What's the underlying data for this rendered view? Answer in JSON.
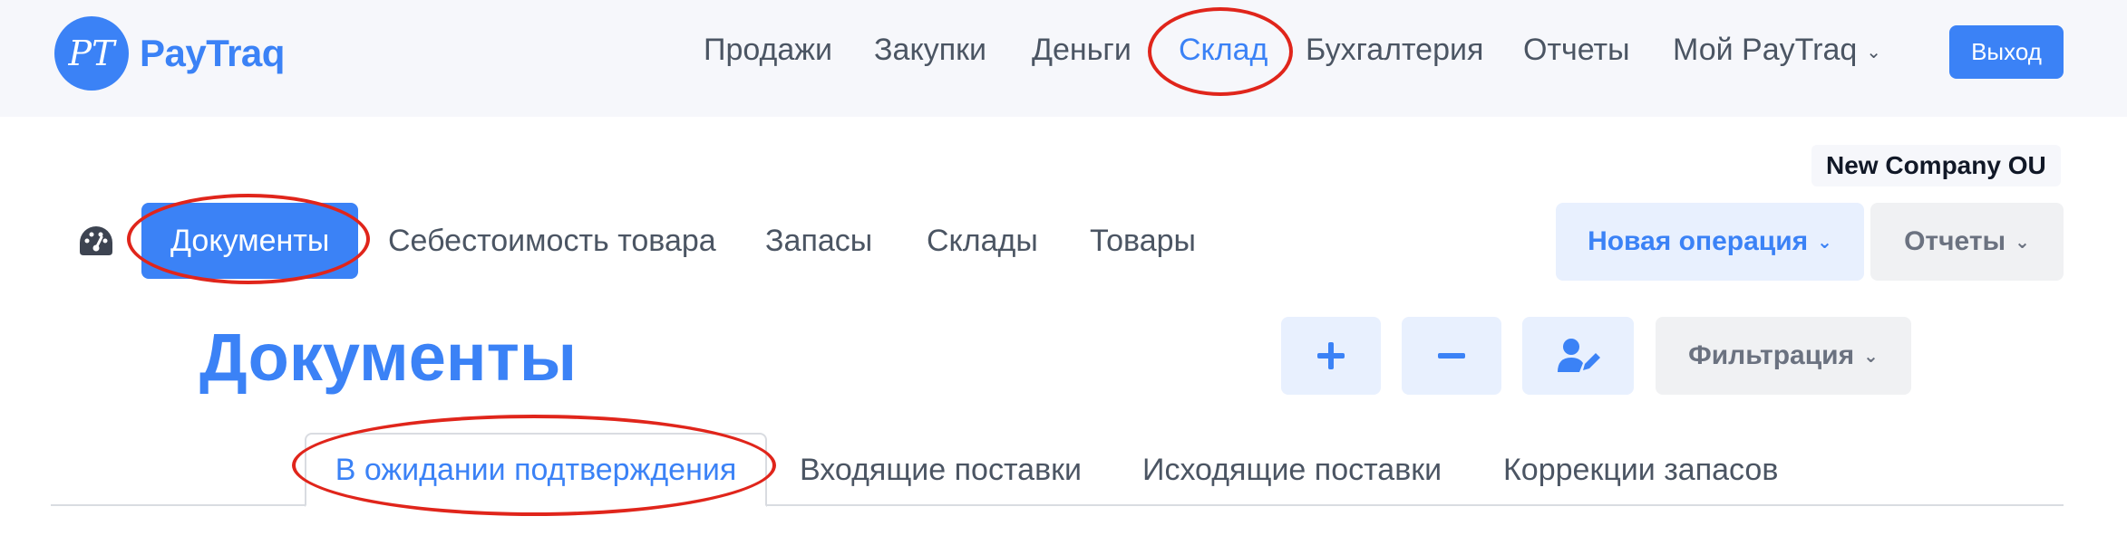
{
  "header": {
    "logo_initials": "PT",
    "brand": "PayTraq",
    "nav": [
      {
        "label": "Продажи"
      },
      {
        "label": "Закупки"
      },
      {
        "label": "Деньги"
      },
      {
        "label": "Склад",
        "active": true
      },
      {
        "label": "Бухгалтерия"
      },
      {
        "label": "Отчеты"
      },
      {
        "label": "Мой PayTraq",
        "dropdown": true
      }
    ],
    "logout_label": "Выход"
  },
  "company": "New Company OU",
  "subnav": {
    "tabs": [
      {
        "label": "Документы",
        "active": true
      },
      {
        "label": "Себестоимость товара"
      },
      {
        "label": "Запасы"
      },
      {
        "label": "Склады"
      },
      {
        "label": "Товары"
      }
    ],
    "new_operation_label": "Новая операция",
    "reports_label": "Отчеты"
  },
  "page": {
    "title": "Документы",
    "actions": [
      {
        "icon": "plus-icon"
      },
      {
        "icon": "minus-icon"
      },
      {
        "icon": "user-edit-icon"
      }
    ],
    "filter_label": "Фильтрация"
  },
  "doc_tabs": [
    {
      "label": "В ожидании подтверждения",
      "active": true
    },
    {
      "label": "Входящие поставки"
    },
    {
      "label": "Исходящие поставки"
    },
    {
      "label": "Коррекции запасов"
    }
  ],
  "colors": {
    "accent": "#3b82f6",
    "annotation": "#e0251b",
    "header_bg": "#f6f7fb"
  }
}
